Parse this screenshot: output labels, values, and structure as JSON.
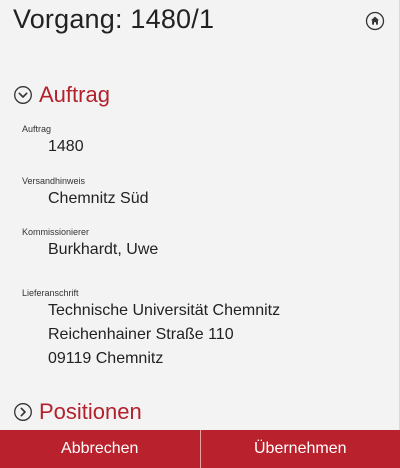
{
  "header": {
    "title": "Vorgang: 1480/1",
    "home_icon": "home-circle-icon"
  },
  "sections": {
    "auftrag": {
      "label": "Auftrag",
      "state": "expanded",
      "icon": "chevron-down-circle-icon"
    },
    "positionen": {
      "label": "Positionen",
      "state": "collapsed",
      "icon": "chevron-right-circle-icon"
    }
  },
  "fields": {
    "auftrag": {
      "label": "Auftrag",
      "value": "1480"
    },
    "versandhinweis": {
      "label": "Versandhinweis",
      "value": "Chemnitz Süd"
    },
    "kommissionierer": {
      "label": "Kommissionierer",
      "value": "Burkhardt, Uwe"
    },
    "lieferanschrift": {
      "label": "Lieferanschrift",
      "lines": [
        "Technische Universität Chemnitz",
        "Reichenhainer Straße 110",
        "09119 Chemnitz"
      ]
    }
  },
  "footer": {
    "cancel_label": "Abbrechen",
    "apply_label": "Übernehmen"
  },
  "colors": {
    "accent": "#b3212c",
    "footer_bg": "#b9222d",
    "background": "#f3f3f3"
  }
}
